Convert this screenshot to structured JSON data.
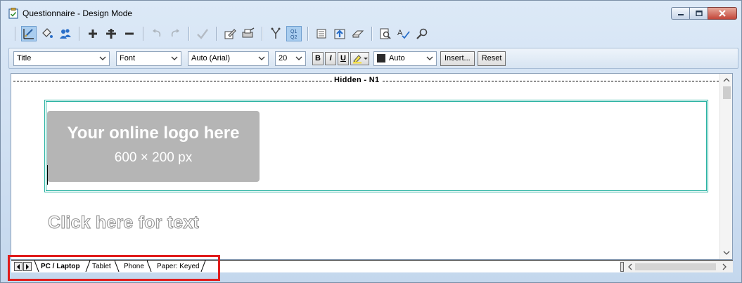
{
  "window": {
    "title": "Questionnaire - Design Mode"
  },
  "format_bar": {
    "style_value": "Title",
    "font_label": "Font",
    "font_name": "Auto (Arial)",
    "font_size": "20",
    "bold": "B",
    "italic": "I",
    "underline": "U",
    "color_value": "Auto",
    "insert_label": "Insert...",
    "reset_label": "Reset"
  },
  "toolbar_icons": [
    "design-icon",
    "fill-icon",
    "users-icon",
    "add-icon",
    "insert-icon",
    "remove-icon",
    "undo-icon",
    "redo-icon",
    "check-icon",
    "edit-icon",
    "print-icon",
    "branch-icon",
    "q1q2-icon",
    "list-icon",
    "upload-icon",
    "eraser-icon",
    "preview-icon",
    "spellcheck-icon",
    "find-icon"
  ],
  "q1q2_text": {
    "line1": "Q1",
    "line2": "Q2"
  },
  "design": {
    "hidden_label": "Hidden - N1",
    "logo_main": "Your online logo here",
    "logo_sub": "600 × 200 px",
    "placeholder": "Click here for text"
  },
  "tabs": [
    {
      "label": "PC / Laptop",
      "active": true
    },
    {
      "label": "Tablet",
      "active": false
    },
    {
      "label": "Phone",
      "active": false
    },
    {
      "label": "Paper: Keyed",
      "active": false
    }
  ],
  "colors": {
    "accent_frame": "#2bb3a3",
    "highlight": "#e01c1c",
    "logo_bg": "#b5b5b5"
  }
}
